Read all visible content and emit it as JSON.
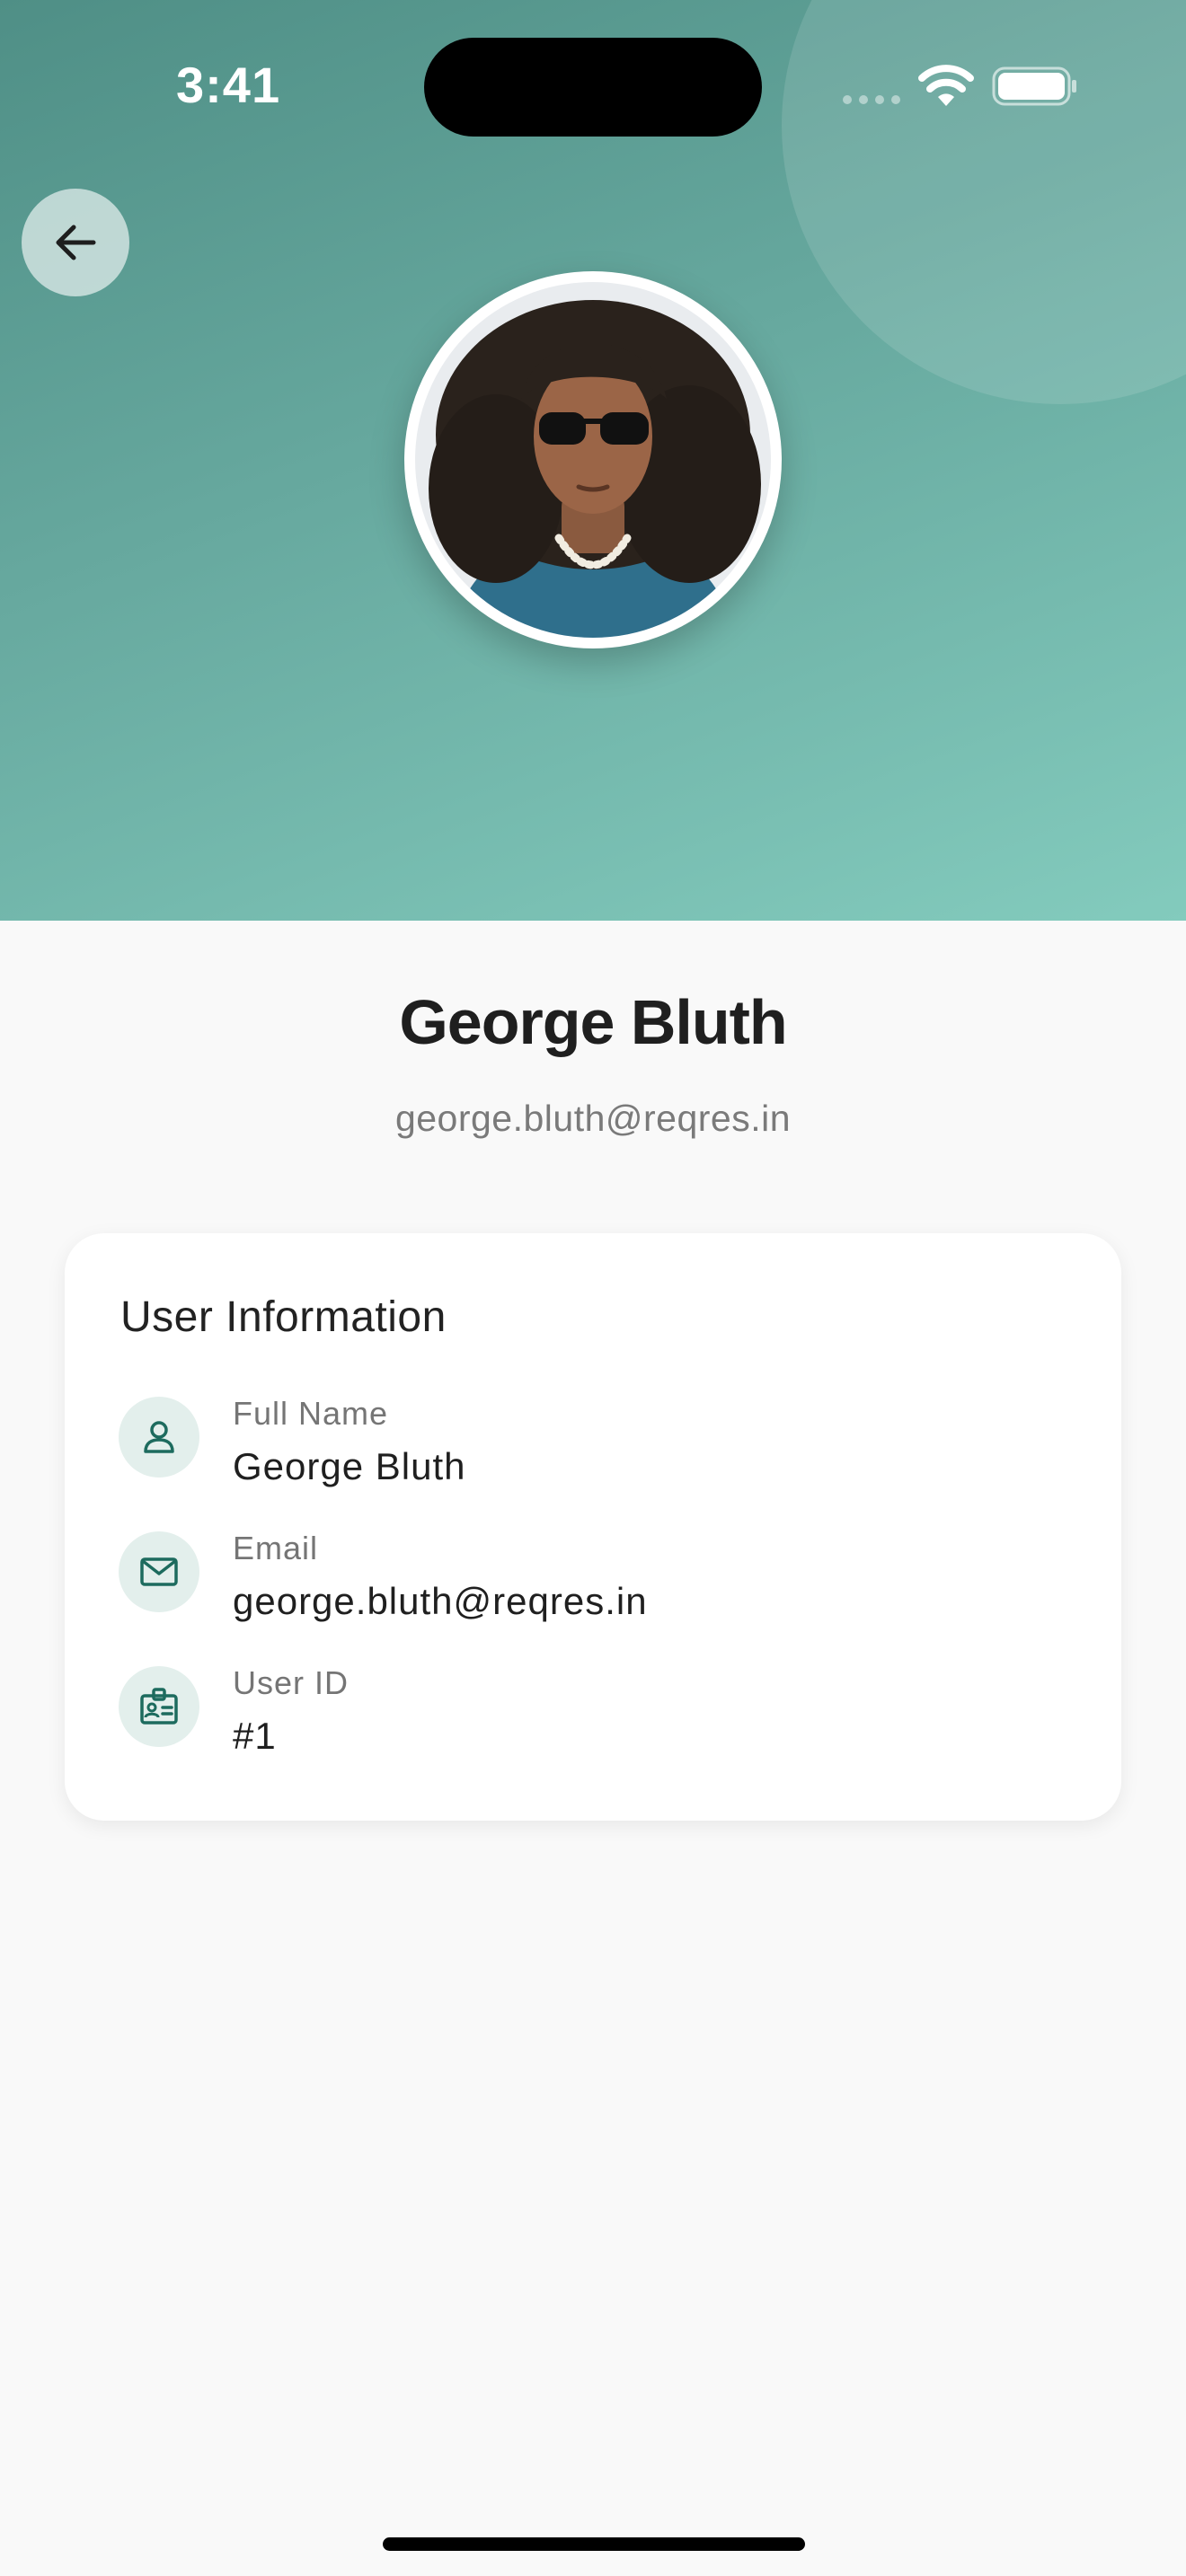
{
  "status_bar": {
    "time": "3:41"
  },
  "header": {
    "back_icon": "arrow-left-icon",
    "avatar_alt": "George Bluth"
  },
  "profile": {
    "name": "George Bluth",
    "email": "george.bluth@reqres.in"
  },
  "card": {
    "title": "User Information",
    "rows": [
      {
        "icon": "person-icon",
        "label": "Full Name",
        "value": "George Bluth"
      },
      {
        "icon": "mail-icon",
        "label": "Email",
        "value": "george.bluth@reqres.in"
      },
      {
        "icon": "id-badge-icon",
        "label": "User ID",
        "value": "#1"
      }
    ]
  },
  "colors": {
    "header_start": "#4f8f86",
    "header_end": "#83cbbd",
    "accent": "#1d6b5e",
    "icon_bg": "#e3efec",
    "background": "#f9f9f9"
  }
}
